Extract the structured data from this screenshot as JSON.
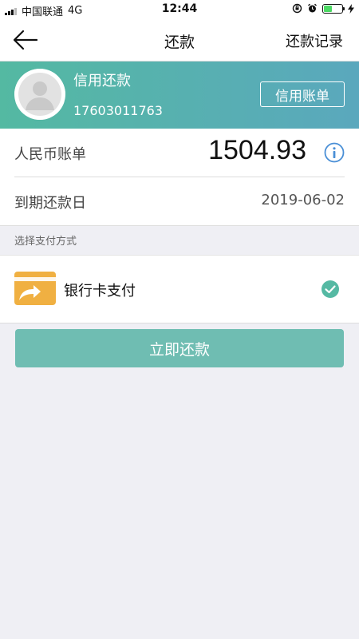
{
  "status_bar": {
    "carrier": "中国联通",
    "network": "4G",
    "time": "12:44"
  },
  "nav": {
    "title": "还款",
    "action": "还款记录"
  },
  "banner": {
    "title": "信用还款",
    "phone": "17603011763",
    "bill_button": "信用账单"
  },
  "bill": {
    "label": "人民币账单",
    "amount": "1504.93"
  },
  "due": {
    "label": "到期还款日",
    "date": "2019-06-02"
  },
  "payment": {
    "section_title": "选择支付方式",
    "method_label": "银行卡支付"
  },
  "submit_label": "立即还款",
  "colors": {
    "accent": "#6fbdb2",
    "banner_start": "#54b9a2",
    "banner_end": "#5aa8bd",
    "info_icon": "#4a8fd6",
    "check": "#55b9a3",
    "card_icon": "#f0b042"
  }
}
